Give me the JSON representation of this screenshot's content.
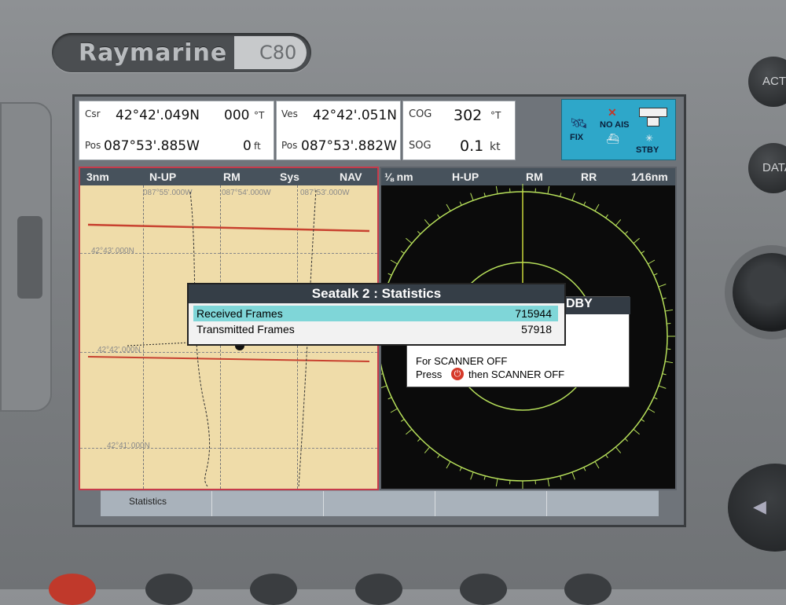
{
  "device": {
    "brand": "Raymarine",
    "model": "C80",
    "side_buttons": [
      "ACT",
      "DATA"
    ]
  },
  "top_panels": {
    "cursor": {
      "csr_label": "Csr",
      "lat": "42°42'.049N",
      "bearing": "000",
      "bearing_unit": "°T",
      "pos_label": "Pos",
      "lon": "087°53'.885W",
      "range": "0",
      "range_unit": "ft"
    },
    "vessel": {
      "ves_label": "Ves",
      "lat": "42°42'.051N",
      "pos_label": "Pos",
      "lon": "087°53'.882W"
    },
    "course": {
      "cog_label": "COG",
      "cog_value": "302",
      "cog_unit": "°T",
      "sog_label": "SOG",
      "sog_value": "0.1",
      "sog_unit": "kt"
    },
    "status": {
      "fix": "FIX",
      "noais": "NO AIS",
      "stby": "STBY"
    }
  },
  "chart_pane": {
    "header": [
      "3nm",
      "N-UP",
      "RM",
      "Sys",
      "NAV"
    ],
    "lon_labels": [
      "087°55'.000W",
      "087°54'.000W",
      "087°53'.000W"
    ],
    "lat_labels": [
      "42°43'.000N",
      "42°42'.000N",
      "42°41'.000N"
    ]
  },
  "radar_pane": {
    "header": [
      "⅛ nm",
      "H-UP",
      "RM",
      "RR",
      "1⁄16nm"
    ]
  },
  "radar_dialog": {
    "title": "DBY",
    "line1": "For SCANNER OFF",
    "line2_pre": "Press",
    "line2_post": "then SCANNER OFF"
  },
  "stats_dialog": {
    "title": "Seatalk 2 : Statistics",
    "rows": [
      {
        "name": "Received Frames",
        "value": "715944"
      },
      {
        "name": "Transmitted Frames",
        "value": "57918"
      }
    ]
  },
  "softkeys": [
    "Statistics",
    "",
    "",
    "",
    ""
  ],
  "colors": {
    "highlight": "#7fd6d8",
    "radar_ring": "#b7e05a",
    "track": "#c8412f",
    "power": "#d63a2a"
  }
}
